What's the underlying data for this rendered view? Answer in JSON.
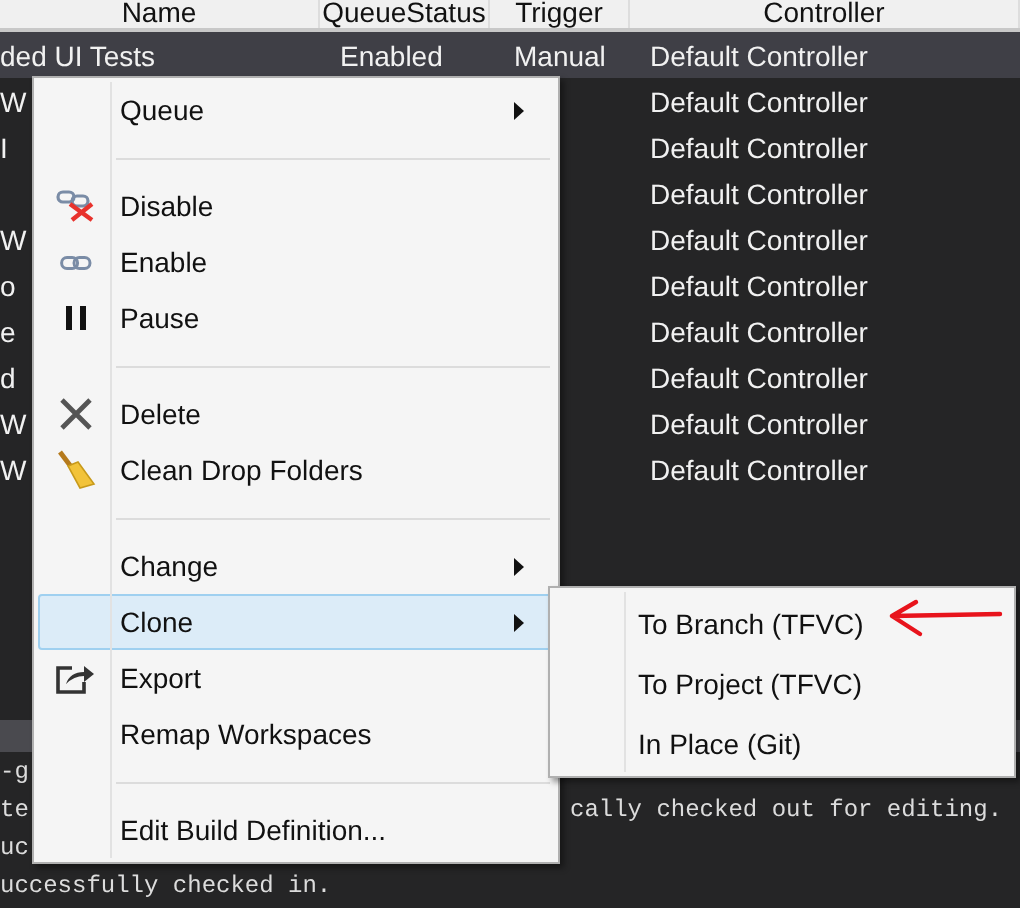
{
  "table": {
    "columns": [
      "Name",
      "QueueStatus",
      "Trigger",
      "Controller"
    ],
    "rows": [
      {
        "name": "ded UI Tests",
        "queue_status": "Enabled",
        "trigger": "Manual",
        "controller": "Default Controller",
        "selected": true
      },
      {
        "name": "W",
        "controller": "Default Controller",
        "selected": false
      },
      {
        "name": "I",
        "controller": "Default Controller",
        "selected": false
      },
      {
        "controller": "Default Controller",
        "selected": false
      },
      {
        "name": "W",
        "controller": "Default Controller",
        "selected": false
      },
      {
        "name": "o",
        "controller": "Default Controller",
        "selected": false
      },
      {
        "name": "e",
        "controller": "Default Controller",
        "selected": false
      },
      {
        "name": "d",
        "controller": "Default Controller",
        "selected": false
      },
      {
        "name": "W",
        "controller": "Default Controller",
        "selected": false
      },
      {
        "name": "W",
        "controller": "Default Controller",
        "selected": false
      }
    ]
  },
  "output": {
    "lines": [
      {
        "left": "-g"
      },
      {
        "left": "te",
        "right": "cally checked out for editing."
      },
      {
        "left": "uc"
      },
      {
        "left": "uccessfully checked in."
      }
    ]
  },
  "context_menu": {
    "items": [
      {
        "kind": "item",
        "label": "Queue",
        "submenu": true,
        "selected": false
      },
      {
        "kind": "separator"
      },
      {
        "kind": "item",
        "label": "Disable",
        "selected": false
      },
      {
        "kind": "item",
        "label": "Enable",
        "selected": false
      },
      {
        "kind": "item",
        "label": "Pause",
        "selected": false
      },
      {
        "kind": "separator"
      },
      {
        "kind": "item",
        "label": "Delete",
        "selected": false
      },
      {
        "kind": "item",
        "label": "Clean Drop Folders",
        "selected": false
      },
      {
        "kind": "separator"
      },
      {
        "kind": "item",
        "label": "Change",
        "submenu": true,
        "selected": false
      },
      {
        "kind": "item",
        "label": "Clone",
        "submenu": true,
        "selected": true
      },
      {
        "kind": "item",
        "label": "Export",
        "selected": false
      },
      {
        "kind": "item",
        "label": "Remap Workspaces",
        "selected": false
      },
      {
        "kind": "separator"
      },
      {
        "kind": "item",
        "label": "Edit Build Definition...",
        "selected": false
      }
    ]
  },
  "submenu": {
    "items": [
      {
        "label": "To Branch (TFVC)",
        "selected": false
      },
      {
        "label": "To Project (TFVC)",
        "selected": false
      },
      {
        "label": "In Place (Git)",
        "selected": false
      }
    ]
  }
}
